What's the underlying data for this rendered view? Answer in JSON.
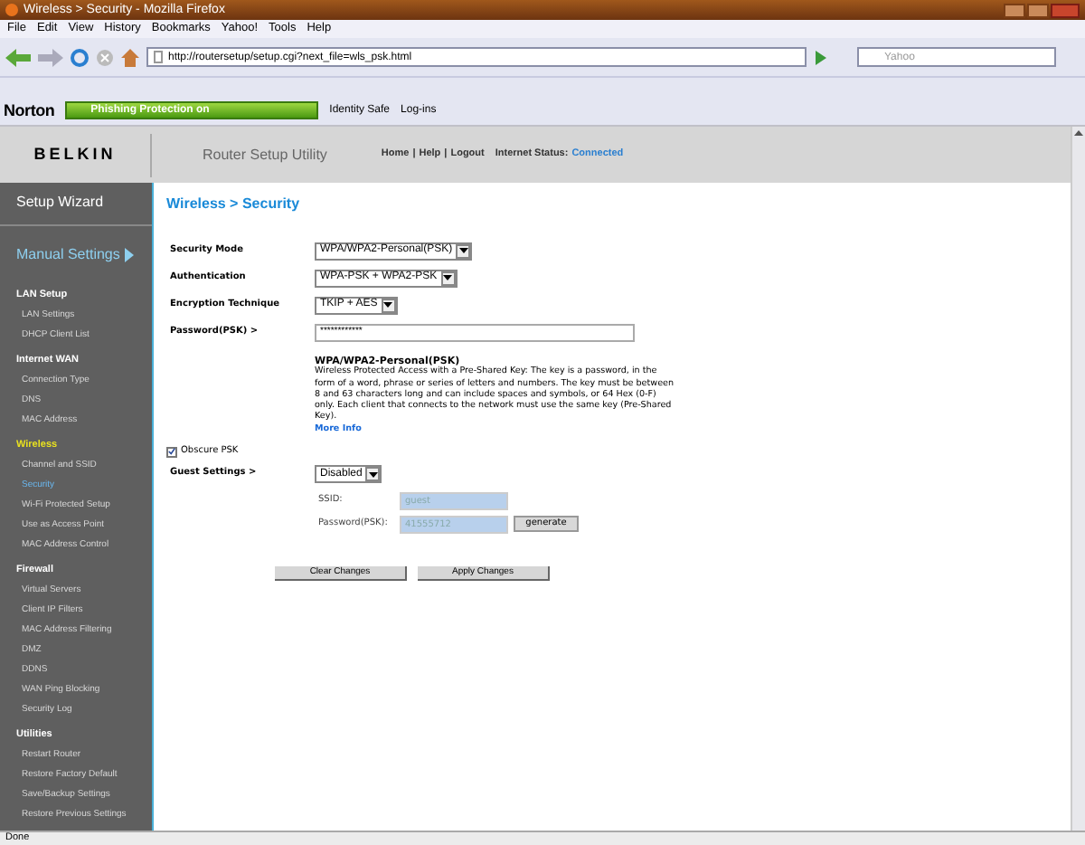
{
  "window": {
    "title": "Wireless > Security - Mozilla Firefox"
  },
  "menu_bar": [
    "File",
    "Edit",
    "View",
    "History",
    "Bookmarks",
    "Yahoo!",
    "Tools",
    "Help"
  ],
  "address_bar": {
    "url": "http://routersetup/setup.cgi?next_file=wls_psk.html"
  },
  "search_field": {
    "placeholder": "Yahoo"
  },
  "norton_toolbar": {
    "brand": "Norton",
    "phishing": "Phishing Protection on",
    "identity": "Identity Safe",
    "logins": "Log-ins"
  },
  "header": {
    "logo": "BELKIN",
    "title": "Router Setup Utility",
    "links": [
      {
        "label": "Home",
        "separator": "|"
      },
      {
        "label": "Help",
        "separator": "|"
      },
      {
        "label": "Logout"
      }
    ],
    "status_label": "Internet Status:",
    "status_value": "Connected"
  },
  "sidebar": {
    "wizard": "Setup Wizard",
    "manual": "Manual Settings",
    "sections": [
      {
        "heading": "LAN Setup",
        "selected": false,
        "items": [
          {
            "label": "LAN Settings",
            "selected": false
          },
          {
            "label": "DHCP Client List",
            "selected": false
          }
        ]
      },
      {
        "heading": "Internet WAN",
        "selected": false,
        "items": [
          {
            "label": "Connection Type",
            "selected": false
          },
          {
            "label": "DNS",
            "selected": false
          },
          {
            "label": "MAC Address",
            "selected": false
          }
        ]
      },
      {
        "heading": "Wireless",
        "selected": true,
        "items": [
          {
            "label": "Channel and SSID",
            "selected": false
          },
          {
            "label": "Security",
            "selected": true
          },
          {
            "label": "Wi-Fi Protected Setup",
            "selected": false
          },
          {
            "label": "Use as Access Point",
            "selected": false
          },
          {
            "label": "MAC Address Control",
            "selected": false
          }
        ]
      },
      {
        "heading": "Firewall",
        "selected": false,
        "items": [
          {
            "label": "Virtual Servers",
            "selected": false
          },
          {
            "label": "Client IP Filters",
            "selected": false
          },
          {
            "label": "MAC Address Filtering",
            "selected": false
          },
          {
            "label": "DMZ",
            "selected": false
          },
          {
            "label": "DDNS",
            "selected": false
          },
          {
            "label": "WAN Ping Blocking",
            "selected": false
          },
          {
            "label": "Security Log",
            "selected": false
          }
        ]
      },
      {
        "heading": "Utilities",
        "selected": false,
        "items": [
          {
            "label": "Restart Router",
            "selected": false
          },
          {
            "label": "Restore Factory Default",
            "selected": false
          },
          {
            "label": "Save/Backup Settings",
            "selected": false
          },
          {
            "label": "Restore Previous Settings",
            "selected": false
          }
        ]
      }
    ]
  },
  "page": {
    "breadcrumb": "Wireless > Security",
    "fields": [
      {
        "label": "Security Mode",
        "kind": "select",
        "value": "WPA/WPA2-Personal(PSK)"
      },
      {
        "label": "Authentication",
        "kind": "select",
        "value": "WPA-PSK + WPA2-PSK"
      },
      {
        "label": "Encryption Technique",
        "kind": "select",
        "value": "TKIP + AES"
      },
      {
        "label": "Password(PSK) >",
        "kind": "password",
        "value": "************"
      }
    ],
    "description": {
      "title": "WPA/WPA2-Personal(PSK)",
      "body": "Wireless Protected Access with a Pre-Shared Key: The key is a password, in the form of a word, phrase or series of letters and numbers. The key must be between 8 and 63 characters long and can include spaces and symbols, or 64 Hex (0-F) only. Each client that connects to the network must use the same key (Pre-Shared Key).",
      "link": "More Info"
    },
    "obscure": {
      "label": "Obscure PSK",
      "checked": true
    },
    "guest": {
      "label": "Guest Settings >",
      "value": "Disabled",
      "ssid_label": "SSID:",
      "ssid_value": "guest",
      "password_label": "Password(PSK):",
      "password_value": "41555712",
      "disabled": true,
      "generate": "generate"
    },
    "buttons": [
      "Clear Changes",
      "Apply Changes"
    ]
  },
  "status_bar": "Done"
}
